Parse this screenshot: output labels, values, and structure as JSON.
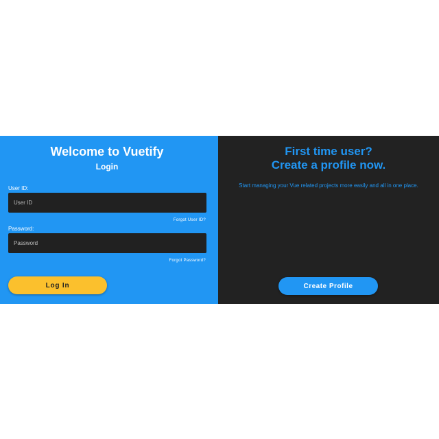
{
  "login": {
    "title": "Welcome to Vuetify",
    "subtitle": "Login",
    "user_id": {
      "label": "User ID:",
      "placeholder": "User ID",
      "value": "",
      "forgot_link": "Forgot User ID?"
    },
    "password": {
      "label": "Password:",
      "placeholder": "Password",
      "value": "",
      "forgot_link": "Forgot Password?"
    },
    "login_button": "Log In"
  },
  "signup": {
    "title_line1": "First time user?",
    "title_line2": "Create a profile now.",
    "description": "Start managing your Vue related projects more easily and all in one place.",
    "create_button": "Create Profile"
  },
  "colors": {
    "login_panel_bg": "#2196f3",
    "signup_panel_bg": "#222222",
    "input_bg": "#212121",
    "login_button_bg": "#fbc02d",
    "create_button_bg": "#2196f3",
    "accent_text": "#2196f3"
  }
}
